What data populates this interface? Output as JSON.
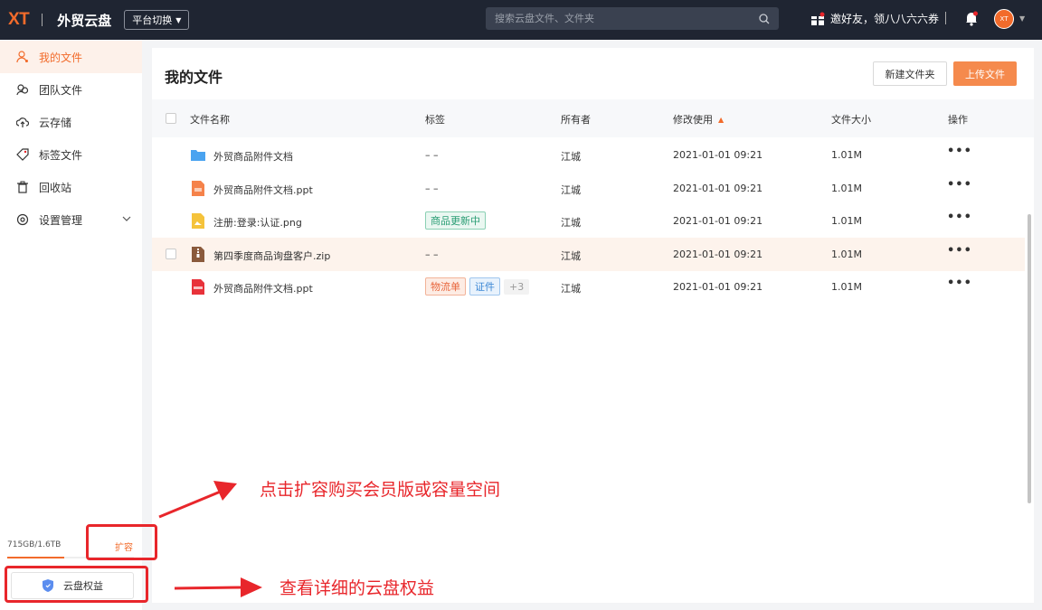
{
  "header": {
    "logo": "XT",
    "app_name": "外贸云盘",
    "platform_switch": "平台切换",
    "search_placeholder": "搜索云盘文件、文件夹",
    "invite_text": "邀好友，领八八六六券",
    "avatar_text": "XT"
  },
  "sidebar": {
    "items": [
      {
        "label": "我的文件",
        "icon": "user-file-icon",
        "active": true
      },
      {
        "label": "团队文件",
        "icon": "team-icon"
      },
      {
        "label": "云存储",
        "icon": "cloud-icon"
      },
      {
        "label": "标签文件",
        "icon": "tag-icon"
      },
      {
        "label": "回收站",
        "icon": "trash-icon"
      },
      {
        "label": "设置管理",
        "icon": "settings-icon"
      }
    ],
    "storage_used": "715GB/1.6TB",
    "storage_fraction": 0.45,
    "expand_label": "扩容",
    "benefit_label": "云盘权益"
  },
  "main": {
    "title": "我的文件",
    "new_folder_label": "新建文件夹",
    "upload_label": "上传文件",
    "columns": [
      "文件名称",
      "标签",
      "所有者",
      "修改使用",
      "文件大小",
      "操作"
    ],
    "rows": [
      {
        "name": "外贸商品附件文档",
        "type": "folder",
        "tags": "– –",
        "owner": "江城",
        "modified": "2021-01-01 09:21",
        "size": "1.01M",
        "ops": "•••"
      },
      {
        "name": "外贸商品附件文档.ppt",
        "type": "ppt",
        "tags": "– –",
        "owner": "江城",
        "modified": "2021-01-01 09:21",
        "size": "1.01M",
        "ops": "•••"
      },
      {
        "name": "注册:登录:认证.png",
        "type": "png",
        "tag_list": [
          "商品更新中"
        ],
        "owner": "江城",
        "modified": "2021-01-01 09:21",
        "size": "1.01M",
        "ops": "•••"
      },
      {
        "name": "第四季度商品询盘客户.zip",
        "type": "zip",
        "tags": "– –",
        "owner": "江城",
        "modified": "2021-01-01 09:21",
        "size": "1.01M",
        "ops": "•••"
      },
      {
        "name": "外贸商品附件文档.ppt",
        "type": "pdf",
        "tag_list": [
          "物流单",
          "证件",
          "+3"
        ],
        "owner": "江城",
        "modified": "2021-01-01 09:21",
        "size": "1.01M",
        "ops": "•••"
      }
    ]
  },
  "annotations": {
    "expand_hint": "点击扩容购买会员版或容量空间",
    "benefit_hint": "查看详细的云盘权益"
  },
  "colors": {
    "brand": "#f26b2b",
    "topbar": "#1f2532",
    "annotation": "#e8262b"
  }
}
